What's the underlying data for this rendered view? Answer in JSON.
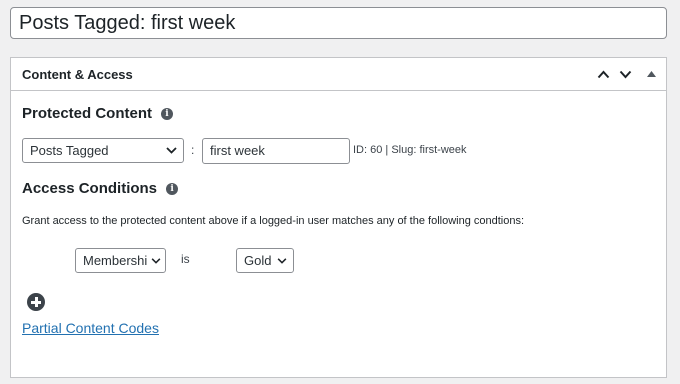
{
  "post_title": "Posts Tagged: first week",
  "postbox": {
    "title": "Content & Access",
    "icons": [
      "chevron-up-icon",
      "chevron-down-icon",
      "triangle-up-icon"
    ]
  },
  "protected_content": {
    "heading": "Protected Content",
    "info_icon": "i",
    "type_select": "Posts Tagged",
    "separator": ":",
    "tag_value": "first week",
    "meta": "ID: 60 | Slug: first-week"
  },
  "access_conditions": {
    "heading": "Access Conditions",
    "info_icon": "i",
    "description": "Grant access to the protected content above if a logged-in user matches any of the following condtions:",
    "rule": {
      "field_select": "Membershi",
      "operator": "is",
      "value_select": "Gold"
    }
  },
  "partial_content_link": "Partial Content Codes",
  "colors": {
    "accent": "#2271b1",
    "border": "#c3c4c7",
    "background": "#f0f0f1"
  }
}
